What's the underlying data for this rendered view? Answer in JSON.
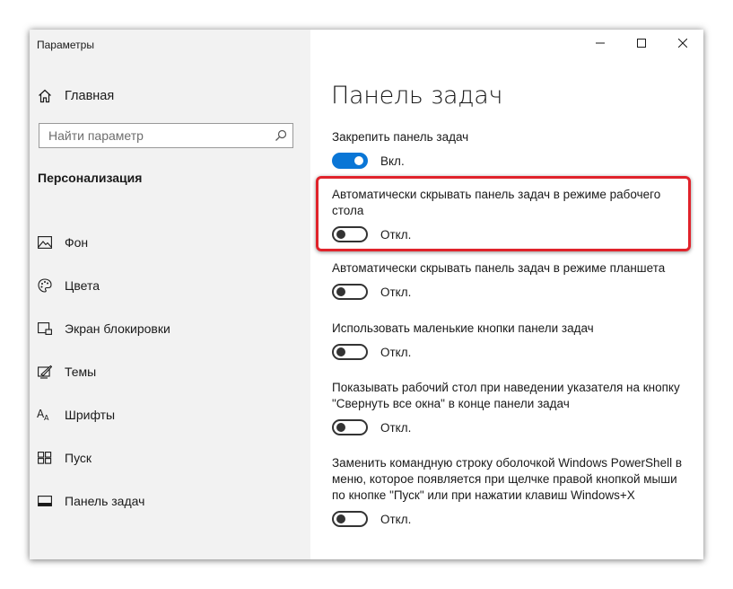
{
  "window": {
    "title": "Параметры",
    "controls": [
      {
        "name": "minimize",
        "icon": "minimize-icon"
      },
      {
        "name": "maximize",
        "icon": "maximize-icon"
      },
      {
        "name": "close",
        "icon": "close-icon"
      }
    ]
  },
  "sidebar": {
    "home": {
      "label": "Главная",
      "icon": "home-icon"
    },
    "search": {
      "placeholder": "Найти параметр",
      "icon": "search-icon"
    },
    "section_title": "Персонализация",
    "items": [
      {
        "label": "Фон",
        "icon": "picture-icon"
      },
      {
        "label": "Цвета",
        "icon": "palette-icon"
      },
      {
        "label": "Экран блокировки",
        "icon": "lock-screen-icon"
      },
      {
        "label": "Темы",
        "icon": "themes-icon"
      },
      {
        "label": "Шрифты",
        "icon": "fonts-icon"
      },
      {
        "label": "Пуск",
        "icon": "start-icon"
      },
      {
        "label": "Панель задач",
        "icon": "taskbar-icon"
      }
    ]
  },
  "main": {
    "title": "Панель задач",
    "settings": [
      {
        "label": "Закрепить панель задач",
        "state": "Вкл.",
        "on": true
      },
      {
        "label": "Автоматически скрывать панель задач в режиме рабочего стола",
        "state": "Откл.",
        "on": false,
        "highlighted": true
      },
      {
        "label": "Автоматически скрывать панель задач в режиме планшета",
        "state": "Откл.",
        "on": false
      },
      {
        "label": "Использовать маленькие кнопки панели задач",
        "state": "Откл.",
        "on": false
      },
      {
        "label": "Показывать рабочий стол при наведении указателя на кнопку \"Свернуть все окна\" в конце панели задач",
        "state": "Откл.",
        "on": false
      },
      {
        "label": "Заменить командную строку оболочкой Windows PowerShell в меню, которое появляется при щелчке правой кнопкой мыши по кнопке \"Пуск\" или при нажатии клавиш Windows+X",
        "state": "Откл.",
        "on": false
      }
    ]
  },
  "colors": {
    "accent": "#0a76d6",
    "highlight": "#e0232b",
    "sidebar_bg": "#f2f2f2"
  }
}
